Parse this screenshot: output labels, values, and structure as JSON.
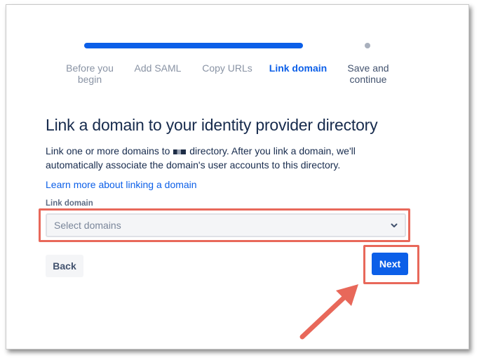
{
  "stepper": {
    "steps": [
      {
        "label": "Before you begin",
        "line1": "Before you",
        "line2": "begin",
        "state": "done"
      },
      {
        "label": "Add SAML",
        "state": "done"
      },
      {
        "label": "Copy URLs",
        "state": "done"
      },
      {
        "label": "Link domain",
        "state": "current"
      },
      {
        "label": "Save and continue",
        "line1": "Save and",
        "line2": "continue",
        "state": "upcoming"
      }
    ]
  },
  "page": {
    "title": "Link a domain to your identity provider directory",
    "description_before": "Link one or more domains to",
    "description_after": "directory. After you link a domain, we'll automatically associate the domain's user accounts to this directory.",
    "learn_more": "Learn more about linking a domain"
  },
  "form": {
    "field_label": "Link domain",
    "select_placeholder": "Select domains"
  },
  "actions": {
    "back_label": "Back",
    "next_label": "Next"
  },
  "colors": {
    "primary": "#0c5fe8",
    "highlight": "#e8685a",
    "text": "#172b4d"
  }
}
